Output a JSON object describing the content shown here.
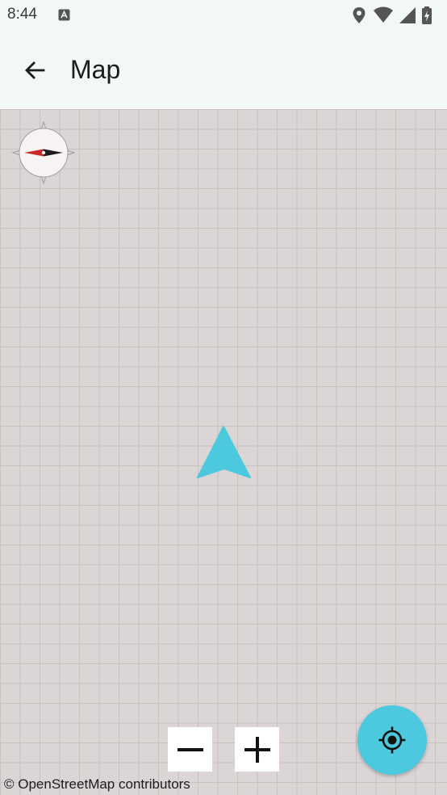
{
  "status_bar": {
    "time": "8:44",
    "icons": [
      "app-notification-icon",
      "location-icon",
      "wifi-icon",
      "signal-icon",
      "battery-icon"
    ]
  },
  "app_bar": {
    "back_icon": "arrow-back-icon",
    "title": "Map"
  },
  "map": {
    "compass_icon": "compass-icon",
    "location_marker_icon": "navigation-arrow-icon",
    "zoom_out_icon": "minus-icon",
    "zoom_in_icon": "plus-icon",
    "my_location_icon": "my-location-icon",
    "attribution": "© OpenStreetMap contributors"
  },
  "colors": {
    "background": "#f2f7f7",
    "map_background": "#dcd5d5",
    "map_grid": "#c9c0c0",
    "accent": "#4cc9de",
    "compass_north": "#c62828",
    "text_primary": "#1c1c1c"
  }
}
